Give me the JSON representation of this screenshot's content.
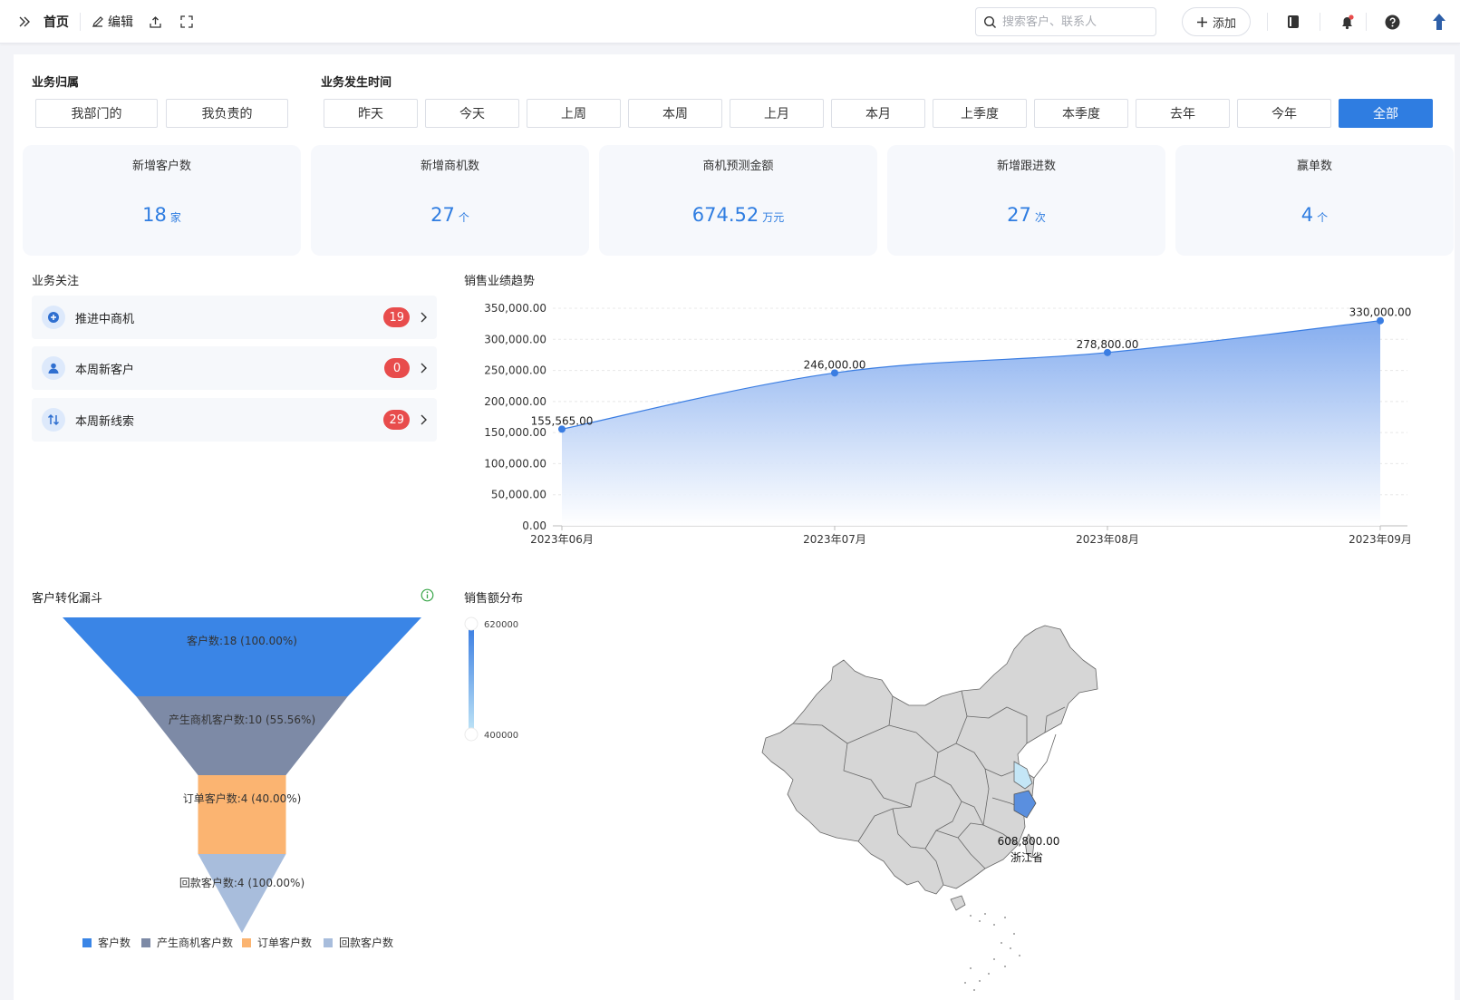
{
  "topbar": {
    "home": "首页",
    "edit": "编辑",
    "search_placeholder": "搜索客户、联系人",
    "add": "添加"
  },
  "filters": {
    "owner_label": "业务归属",
    "owner_options": [
      "我部门的",
      "我负责的"
    ],
    "time_label": "业务发生时间",
    "time_options": [
      "昨天",
      "今天",
      "上周",
      "本周",
      "上月",
      "本月",
      "上季度",
      "本季度",
      "去年",
      "今年",
      "全部"
    ],
    "time_selected": "全部"
  },
  "kpis": [
    {
      "title": "新增客户数",
      "value": "18",
      "unit": "家"
    },
    {
      "title": "新增商机数",
      "value": "27",
      "unit": "个"
    },
    {
      "title": "商机预测金额",
      "value": "674.52",
      "unit": "万元"
    },
    {
      "title": "新增跟进数",
      "value": "27",
      "unit": "次"
    },
    {
      "title": "赢单数",
      "value": "4",
      "unit": "个"
    }
  ],
  "focus": {
    "title": "业务关注",
    "items": [
      {
        "label": "推进中商机",
        "count": "19",
        "icon": "plus-circle-icon"
      },
      {
        "label": "本周新客户",
        "count": "0",
        "icon": "user-icon"
      },
      {
        "label": "本周新线索",
        "count": "29",
        "icon": "swap-icon"
      }
    ]
  },
  "sales_trend": {
    "title": "销售业绩趋势",
    "chart_data": {
      "type": "area",
      "x": [
        "2023年06月",
        "2023年07月",
        "2023年08月",
        "2023年09月"
      ],
      "values": [
        155565.0,
        246000.0,
        278800.0,
        330000.0
      ],
      "data_labels": [
        "155,565.00",
        "246,000.00",
        "278,800.00",
        "330,000.00"
      ],
      "ylim": [
        0,
        350000
      ],
      "yticks": [
        "0.00",
        "50,000.00",
        "100,000.00",
        "150,000.00",
        "200,000.00",
        "250,000.00",
        "300,000.00",
        "350,000.00"
      ],
      "grid": true,
      "color": "#3a7de2"
    }
  },
  "funnel": {
    "title": "客户转化漏斗",
    "chart_data": {
      "type": "funnel",
      "stages": [
        {
          "name": "客户数",
          "value": 18,
          "percent": "100.00%",
          "label": "客户数:18 (100.00%)",
          "color": "#3a85e6"
        },
        {
          "name": "产生商机客户数",
          "value": 10,
          "percent": "55.56%",
          "label": "产生商机客户数:10 (55.56%)",
          "color": "#7d8aa6"
        },
        {
          "name": "订单客户数",
          "value": 4,
          "percent": "40.00%",
          "label": "订单客户数:4 (40.00%)",
          "color": "#fbb471"
        },
        {
          "name": "回款客户数",
          "value": 4,
          "percent": "100.00%",
          "label": "回款客户数:4 (100.00%)",
          "color": "#a8bddc"
        }
      ],
      "legend": [
        "客户数",
        "产生商机客户数",
        "订单客户数",
        "回款客户数"
      ]
    }
  },
  "sales_map": {
    "title": "销售额分布",
    "chart_data": {
      "type": "map",
      "visual_map_max": "620000",
      "visual_map_min": "400000",
      "regions": [
        {
          "name": "浙江省",
          "value": 608800.0,
          "label": "608,800.00"
        }
      ],
      "base_color": "#d6d6d6",
      "highlight_color": "#5a8fdf"
    }
  }
}
